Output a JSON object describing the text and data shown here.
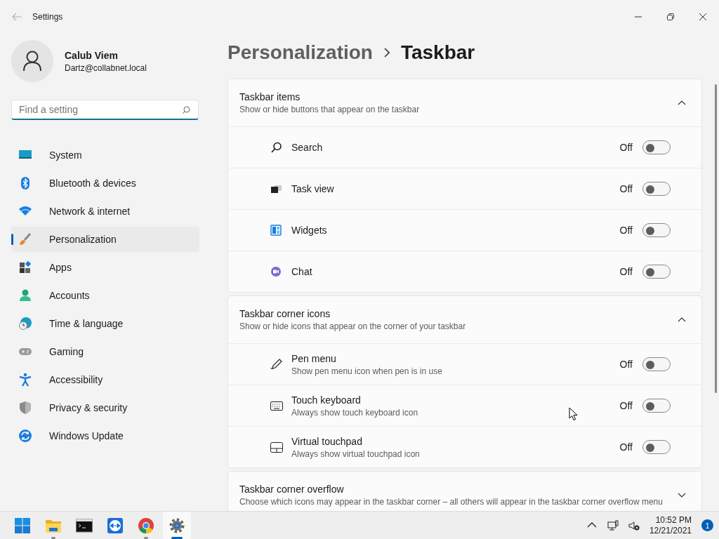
{
  "window": {
    "title": "Settings"
  },
  "user": {
    "name": "Calub Viem",
    "email": "Dartz@collabnet.local"
  },
  "search": {
    "placeholder": "Find a setting"
  },
  "sidebar": {
    "items": [
      {
        "label": "System",
        "selected": false
      },
      {
        "label": "Bluetooth & devices",
        "selected": false
      },
      {
        "label": "Network & internet",
        "selected": false
      },
      {
        "label": "Personalization",
        "selected": true
      },
      {
        "label": "Apps",
        "selected": false
      },
      {
        "label": "Accounts",
        "selected": false
      },
      {
        "label": "Time & language",
        "selected": false
      },
      {
        "label": "Gaming",
        "selected": false
      },
      {
        "label": "Accessibility",
        "selected": false
      },
      {
        "label": "Privacy & security",
        "selected": false
      },
      {
        "label": "Windows Update",
        "selected": false
      }
    ]
  },
  "breadcrumb": [
    "Personalization",
    "Taskbar"
  ],
  "sections": [
    {
      "title": "Taskbar items",
      "description": "Show or hide buttons that appear on the taskbar",
      "expanded": true,
      "rows": [
        {
          "label": "Search",
          "state_label": "Off",
          "on": false
        },
        {
          "label": "Task view",
          "state_label": "Off",
          "on": false
        },
        {
          "label": "Widgets",
          "state_label": "Off",
          "on": false
        },
        {
          "label": "Chat",
          "state_label": "Off",
          "on": false
        }
      ]
    },
    {
      "title": "Taskbar corner icons",
      "description": "Show or hide icons that appear on the corner of your taskbar",
      "expanded": true,
      "rows": [
        {
          "label": "Pen menu",
          "description": "Show pen menu icon when pen is in use",
          "state_label": "Off",
          "on": false
        },
        {
          "label": "Touch keyboard",
          "description": "Always show touch keyboard icon",
          "state_label": "Off",
          "on": false
        },
        {
          "label": "Virtual touchpad",
          "description": "Always show virtual touchpad icon",
          "state_label": "Off",
          "on": false
        }
      ]
    },
    {
      "title": "Taskbar corner overflow",
      "description": "Choose which icons may appear in the taskbar corner – all others will appear in the taskbar corner overflow menu",
      "expanded": false
    }
  ],
  "taskbar": {
    "apps": [
      {
        "running": false,
        "selected": false
      },
      {
        "running": true,
        "selected": false
      },
      {
        "running": false,
        "selected": false
      },
      {
        "running": false,
        "selected": false
      },
      {
        "running": true,
        "selected": false
      },
      {
        "running": true,
        "selected": true
      }
    ],
    "time": "10:52 PM",
    "date": "12/21/2021",
    "notifications": "1"
  }
}
